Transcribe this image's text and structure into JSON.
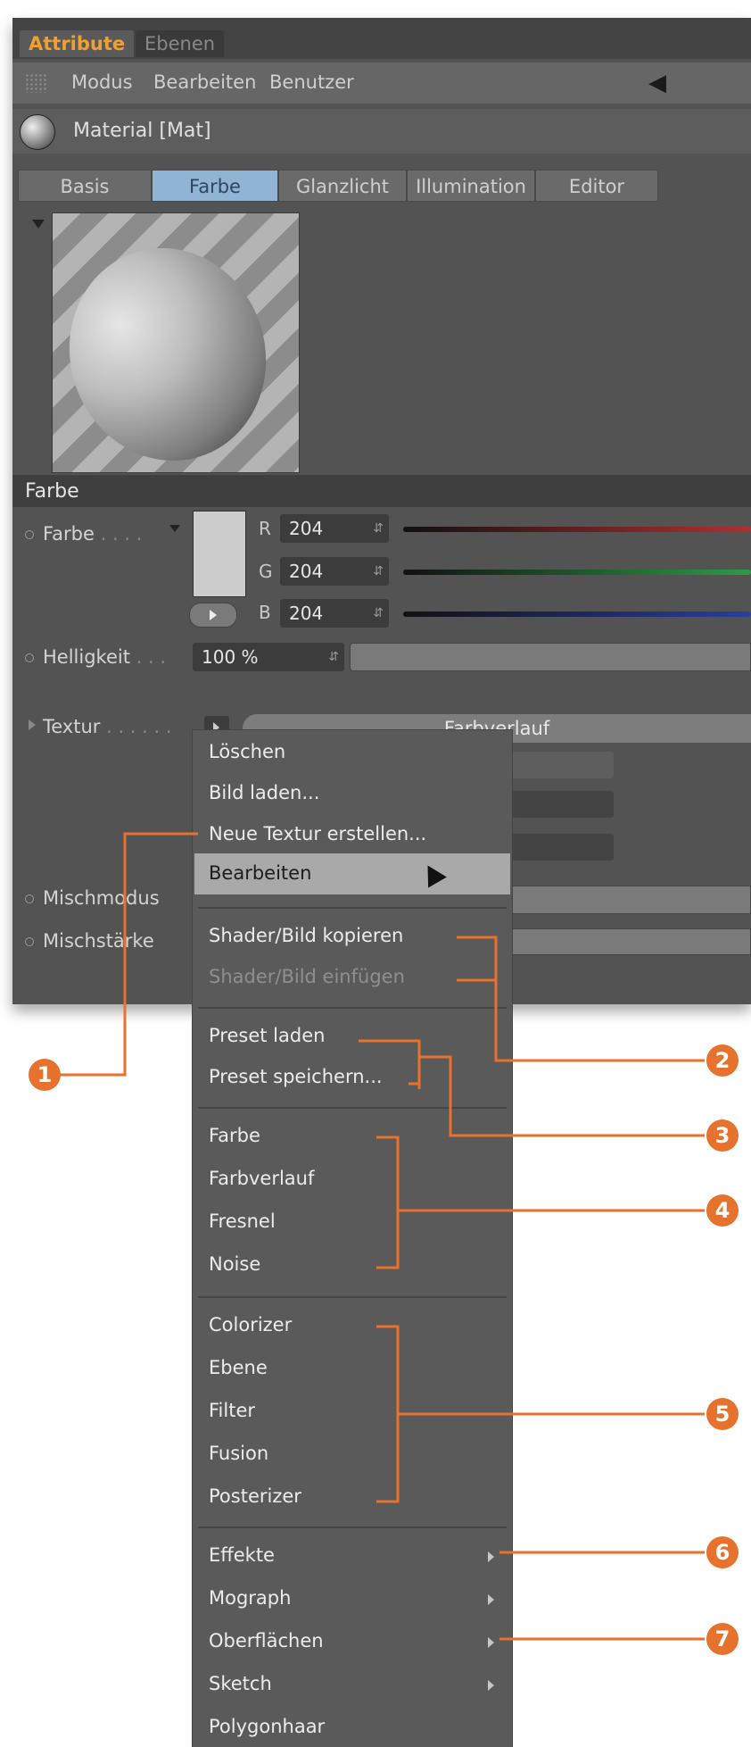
{
  "panel": {
    "tabs": {
      "active": "Attribute",
      "inactive": "Ebenen"
    },
    "menubar": {
      "modus": "Modus",
      "bearbeiten": "Bearbeiten",
      "benutzer": "Benutzer",
      "back_icon": "back-arrow-icon"
    },
    "material_title": "Material [Mat]",
    "material_tabs": [
      "Basis",
      "Farbe",
      "Glanzlicht",
      "Illumination",
      "Editor"
    ],
    "selected_material_tab": "Farbe",
    "section_title": "Farbe",
    "farbe": {
      "label": "Farbe",
      "dots": ". . . .",
      "swatch_color": "#cccccc",
      "channels": [
        {
          "name": "R",
          "value": "204",
          "slider_color": "#b03030"
        },
        {
          "name": "G",
          "value": "204",
          "slider_color": "#2e9a46"
        },
        {
          "name": "B",
          "value": "204",
          "slider_color": "#2a3e9e"
        }
      ]
    },
    "helligkeit": {
      "label": "Helligkeit",
      "dots": ". . .",
      "value": "100 %"
    },
    "textur": {
      "label": "Textur",
      "dots": ". . . . . .",
      "value": "Farbverlauf"
    },
    "mischmodus": {
      "label": "Mischmodus"
    },
    "mischstaerke": {
      "label": "Mischstärke"
    }
  },
  "context_menu": {
    "items": [
      "Löschen",
      "Bild laden...",
      "Neue Textur erstellen...",
      "Bearbeiten",
      "Shader/Bild kopieren",
      "Shader/Bild einfügen",
      "Preset laden",
      "Preset speichern...",
      "Farbe",
      "Farbverlauf",
      "Fresnel",
      "Noise",
      "Colorizer",
      "Ebene",
      "Filter",
      "Fusion",
      "Posterizer",
      "Effekte",
      "Mograph",
      "Oberflächen",
      "Sketch",
      "Polygonhaar"
    ],
    "highlighted": "Bearbeiten"
  },
  "callouts": {
    "accent": "#e6722e",
    "numbers": [
      "1",
      "2",
      "3",
      "4",
      "5",
      "6",
      "7"
    ]
  }
}
